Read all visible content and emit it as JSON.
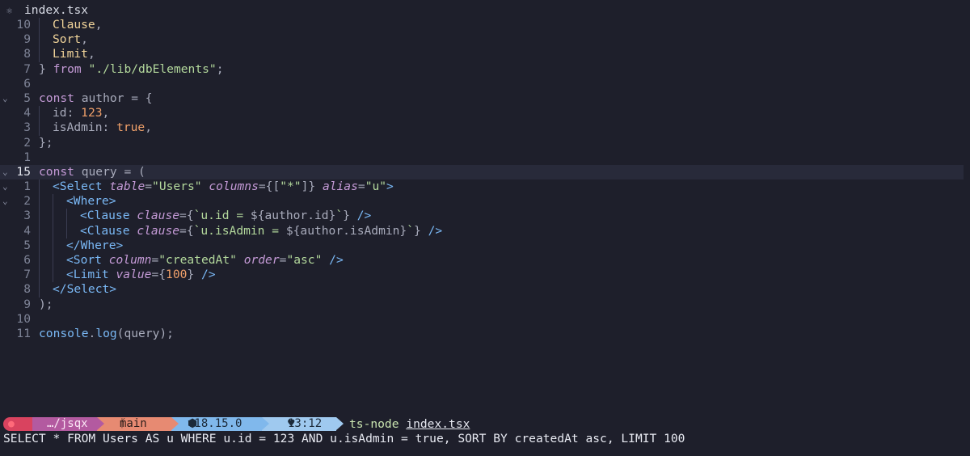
{
  "tab": {
    "icon": "react-icon",
    "filename": "index.tsx"
  },
  "editor": {
    "lines": [
      {
        "fold": "",
        "num": "10",
        "indent": 1,
        "current": false,
        "tokens": [
          [
            "ty",
            "Clause"
          ],
          [
            "pun",
            ","
          ]
        ]
      },
      {
        "fold": "",
        "num": "9",
        "indent": 1,
        "current": false,
        "tokens": [
          [
            "ty",
            "Sort"
          ],
          [
            "pun",
            ","
          ]
        ]
      },
      {
        "fold": "",
        "num": "8",
        "indent": 1,
        "current": false,
        "tokens": [
          [
            "ty",
            "Limit"
          ],
          [
            "pun",
            ","
          ]
        ]
      },
      {
        "fold": "",
        "num": "7",
        "indent": 0,
        "current": false,
        "tokens": [
          [
            "pun",
            "} "
          ],
          [
            "kw",
            "from"
          ],
          [
            "pun",
            " "
          ],
          [
            "str",
            "\"./lib/dbElements\""
          ],
          [
            "pun",
            ";"
          ]
        ]
      },
      {
        "fold": "",
        "num": "6",
        "indent": 0,
        "current": false,
        "tokens": []
      },
      {
        "fold": "⌄",
        "num": "5",
        "indent": 0,
        "current": false,
        "tokens": [
          [
            "kw",
            "const"
          ],
          [
            "pun",
            " author = {"
          ]
        ]
      },
      {
        "fold": "",
        "num": "4",
        "indent": 1,
        "current": false,
        "tokens": [
          [
            "pun",
            "id: "
          ],
          [
            "num",
            "123"
          ],
          [
            "pun",
            ","
          ]
        ]
      },
      {
        "fold": "",
        "num": "3",
        "indent": 1,
        "current": false,
        "tokens": [
          [
            "pun",
            "isAdmin: "
          ],
          [
            "num",
            "true"
          ],
          [
            "pun",
            ","
          ]
        ]
      },
      {
        "fold": "",
        "num": "2",
        "indent": 0,
        "current": false,
        "tokens": [
          [
            "pun",
            "};"
          ]
        ]
      },
      {
        "fold": "",
        "num": "1",
        "indent": 0,
        "current": false,
        "tokens": []
      },
      {
        "fold": "⌄",
        "num": "15",
        "indent": 0,
        "current": true,
        "tokens": [
          [
            "kw",
            "const"
          ],
          [
            "pun",
            " query = ("
          ]
        ]
      },
      {
        "fold": "⌄",
        "num": "1",
        "indent": 1,
        "current": false,
        "tokens": [
          [
            "tag",
            "<Select"
          ],
          [
            "pun",
            " "
          ],
          [
            "attr",
            "table"
          ],
          [
            "pun",
            "="
          ],
          [
            "str",
            "\"Users\""
          ],
          [
            "pun",
            " "
          ],
          [
            "attr",
            "columns"
          ],
          [
            "pun",
            "={["
          ],
          [
            "str",
            "\"*\""
          ],
          [
            "pun",
            "]} "
          ],
          [
            "attr",
            "alias"
          ],
          [
            "pun",
            "="
          ],
          [
            "str",
            "\"u\""
          ],
          [
            "tag",
            ">"
          ]
        ]
      },
      {
        "fold": "⌄",
        "num": "2",
        "indent": 2,
        "current": false,
        "tokens": [
          [
            "tag",
            "<Where>"
          ]
        ]
      },
      {
        "fold": "",
        "num": "3",
        "indent": 3,
        "current": false,
        "tokens": [
          [
            "tag",
            "<Clause"
          ],
          [
            "pun",
            " "
          ],
          [
            "attr",
            "clause"
          ],
          [
            "pun",
            "={"
          ],
          [
            "str",
            "`u.id = "
          ],
          [
            "pun",
            "${author.id}"
          ],
          [
            "str",
            "`"
          ],
          [
            "pun",
            "} "
          ],
          [
            "tag",
            "/>"
          ]
        ]
      },
      {
        "fold": "",
        "num": "4",
        "indent": 3,
        "current": false,
        "tokens": [
          [
            "tag",
            "<Clause"
          ],
          [
            "pun",
            " "
          ],
          [
            "attr",
            "clause"
          ],
          [
            "pun",
            "={"
          ],
          [
            "str",
            "`u.isAdmin = "
          ],
          [
            "pun",
            "${author.isAdmin}"
          ],
          [
            "str",
            "`"
          ],
          [
            "pun",
            "} "
          ],
          [
            "tag",
            "/>"
          ]
        ]
      },
      {
        "fold": "",
        "num": "5",
        "indent": 2,
        "current": false,
        "tokens": [
          [
            "tag",
            "</Where>"
          ]
        ]
      },
      {
        "fold": "",
        "num": "6",
        "indent": 2,
        "current": false,
        "tokens": [
          [
            "tag",
            "<Sort"
          ],
          [
            "pun",
            " "
          ],
          [
            "attr",
            "column"
          ],
          [
            "pun",
            "="
          ],
          [
            "str",
            "\"createdAt\""
          ],
          [
            "pun",
            " "
          ],
          [
            "attr",
            "order"
          ],
          [
            "pun",
            "="
          ],
          [
            "str",
            "\"asc\""
          ],
          [
            "pun",
            " "
          ],
          [
            "tag",
            "/>"
          ]
        ]
      },
      {
        "fold": "",
        "num": "7",
        "indent": 2,
        "current": false,
        "tokens": [
          [
            "tag",
            "<Limit"
          ],
          [
            "pun",
            " "
          ],
          [
            "attr",
            "value"
          ],
          [
            "pun",
            "={"
          ],
          [
            "num",
            "100"
          ],
          [
            "pun",
            "} "
          ],
          [
            "tag",
            "/>"
          ]
        ]
      },
      {
        "fold": "",
        "num": "8",
        "indent": 1,
        "current": false,
        "tokens": [
          [
            "tag",
            "</Select>"
          ]
        ]
      },
      {
        "fold": "",
        "num": "9",
        "indent": 0,
        "current": false,
        "tokens": [
          [
            "pun",
            ");"
          ]
        ]
      },
      {
        "fold": "",
        "num": "10",
        "indent": 0,
        "current": false,
        "tokens": []
      },
      {
        "fold": "",
        "num": "11",
        "indent": 0,
        "current": false,
        "tokens": [
          [
            "fn",
            "console"
          ],
          [
            "pun",
            "."
          ],
          [
            "fn",
            "log"
          ],
          [
            "pun",
            "(query);"
          ]
        ]
      }
    ]
  },
  "terminal": {
    "prompt": {
      "apple_icon": "apple-icon",
      "dir": "…/jsqx",
      "branch_icon": "git-branch-icon",
      "branch": "main",
      "node_icon": "nodejs-icon",
      "node_version": "v18.15.0",
      "time_icon": "heart-icon",
      "time": "13:12"
    },
    "command": "ts-node",
    "command_arg": "index.tsx",
    "output": "SELECT * FROM Users AS u WHERE u.id = 123 AND u.isAdmin = true, SORT BY createdAt asc, LIMIT 100"
  }
}
